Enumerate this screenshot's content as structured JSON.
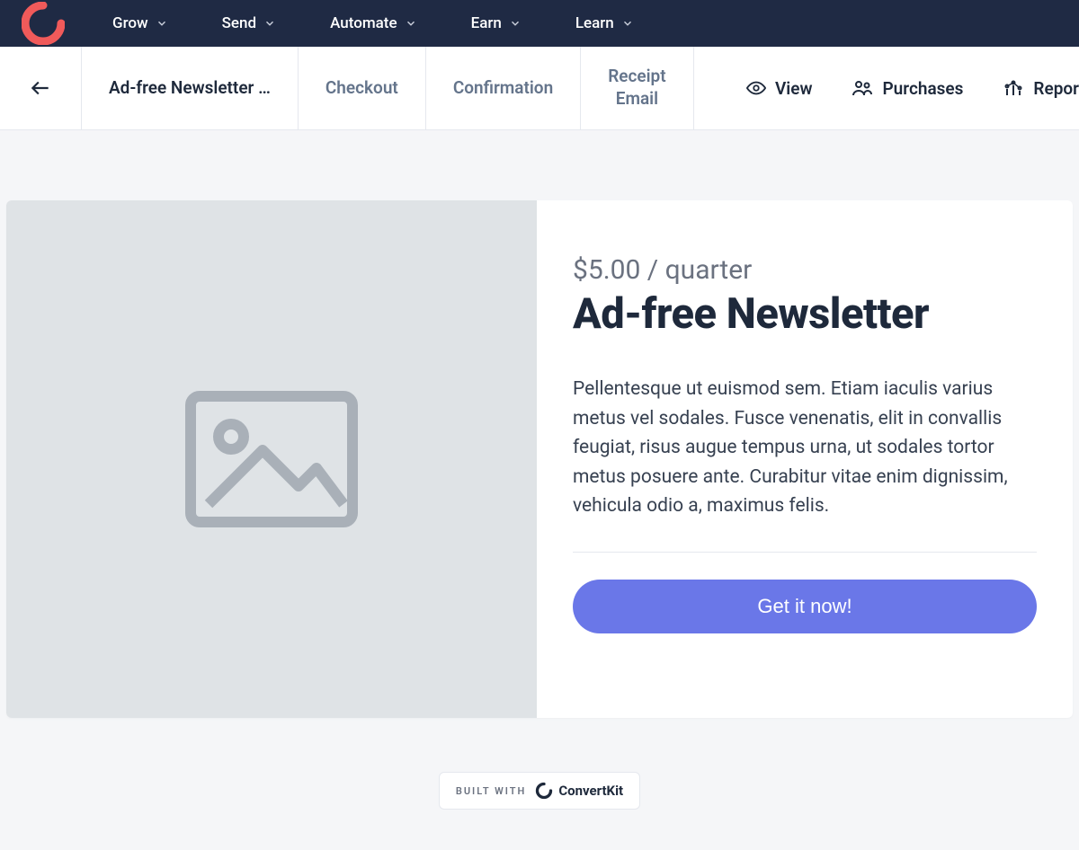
{
  "top_nav": {
    "items": [
      "Grow",
      "Send",
      "Automate",
      "Earn",
      "Learn"
    ]
  },
  "secondary": {
    "tabs": {
      "active": "Ad-free Newsletter …",
      "checkout": "Checkout",
      "confirmation": "Confirmation",
      "receipt_line1": "Receipt",
      "receipt_line2": "Email"
    },
    "actions": {
      "view": "View",
      "purchases": "Purchases",
      "reports": "Repor"
    }
  },
  "product": {
    "price": "$5.00 / quarter",
    "title": "Ad-free Newsletter",
    "description": "Pellentesque ut euismod sem. Etiam iaculis varius metus vel sodales. Fusce venenatis, elit in convallis feugiat, risus augue tempus urna, ut sodales tortor metus posuere ante. Curabitur vitae enim dignissim, vehicula odio a, maximus felis.",
    "cta": "Get it now!"
  },
  "footer": {
    "built_with": "BUILT WITH",
    "brand": "ConvertKit"
  },
  "colors": {
    "nav_bg": "#1f2a44",
    "accent": "#6a77e8",
    "logo": "#f05a5a"
  }
}
